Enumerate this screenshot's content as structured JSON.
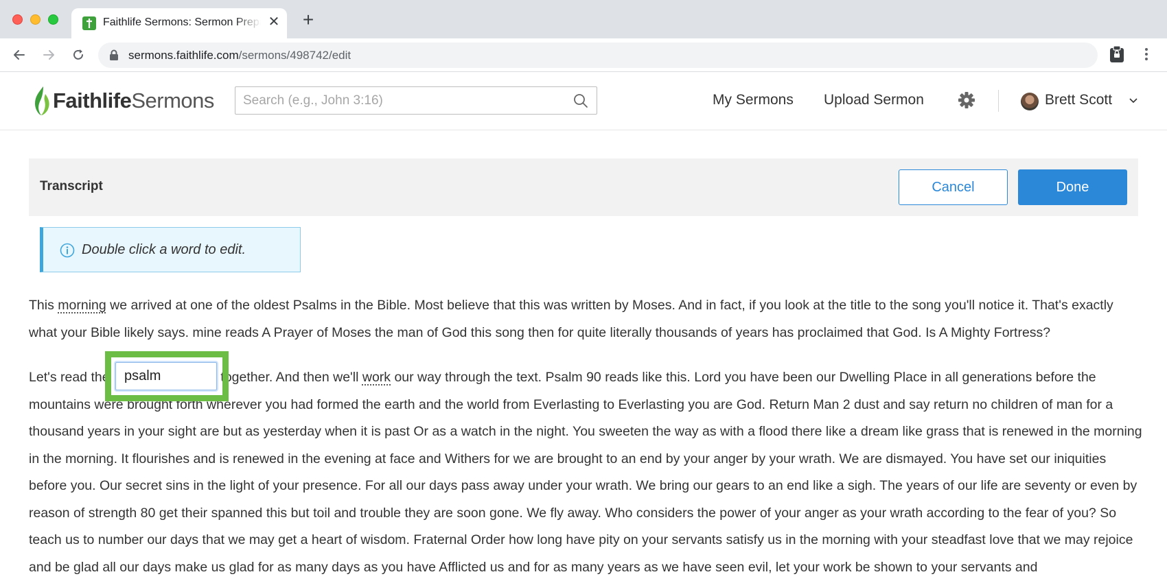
{
  "browser": {
    "tab_title": "Faithlife Sermons: Sermon Preparation",
    "tab_close": "✕",
    "new_tab": "+",
    "url_host": "sermons.faithlife.com",
    "url_path": "/sermons/498742/edit"
  },
  "header": {
    "logo_bold": "Faithlife",
    "logo_light": "Sermons",
    "search_placeholder": "Search (e.g., John 3:16)",
    "nav": {
      "my_sermons": "My Sermons",
      "upload_sermon": "Upload Sermon"
    },
    "user_name": "Brett Scott"
  },
  "panel": {
    "title": "Transcript",
    "cancel_label": "Cancel",
    "done_label": "Done"
  },
  "info": {
    "text": "Double click a word to edit."
  },
  "transcript": {
    "p1_before": "This ",
    "p1_word": "morning",
    "p1_after": " we arrived at one of the oldest Psalms in the Bible. Most believe that this was written by Moses. And in fact, if you look at the title to the song you'll notice it. That's exactly what your Bible likely says. mine reads A Prayer of Moses the man of God this song then for quite literally thousands of years has proclaimed that God. Is A Mighty Fortress?",
    "p2_before": "Let's read the ",
    "p2_mid": " together. And then we'll ",
    "p2_word": "work",
    "p2_after": " our way through the text. Psalm 90 reads like this. Lord you have been our Dwelling Place in all generations before the mountains were brought forth wherever you had formed the earth and the world from Everlasting to Everlasting you are God. Return Man 2 dust and say return no children of man for a thousand years in your sight are but as yesterday when it is past Or as a watch in the night. You sweeten the way as with a flood there like a dream like grass that is renewed in the morning in the morning. It flourishes and is renewed in the evening at face and Withers for we are brought to an end by your anger by your wrath. We are dismayed. You have set our iniquities before you. Our secret sins in the light of your presence. For all our days pass away under your wrath. We bring our gears to an end like a sigh. The years of our life are seventy or even by reason of strength 80 get their spanned this but toil and trouble they are soon gone. We fly away. Who considers the power of your anger as your wrath according to the fear of you? So teach us to number our days that we may get a heart of wisdom. Fraternal Order how long have pity on your servants satisfy us in the morning with your steadfast love that we may rejoice and be glad all our days make us glad for as many days as you have Afflicted us and for as many years as we have seen evil, let your work be shown to your servants and"
  },
  "editing": {
    "value": "psalm"
  },
  "colors": {
    "accent": "#2b88d8",
    "highlight": "#6cbd45",
    "brand_green": "#3fa13b"
  }
}
